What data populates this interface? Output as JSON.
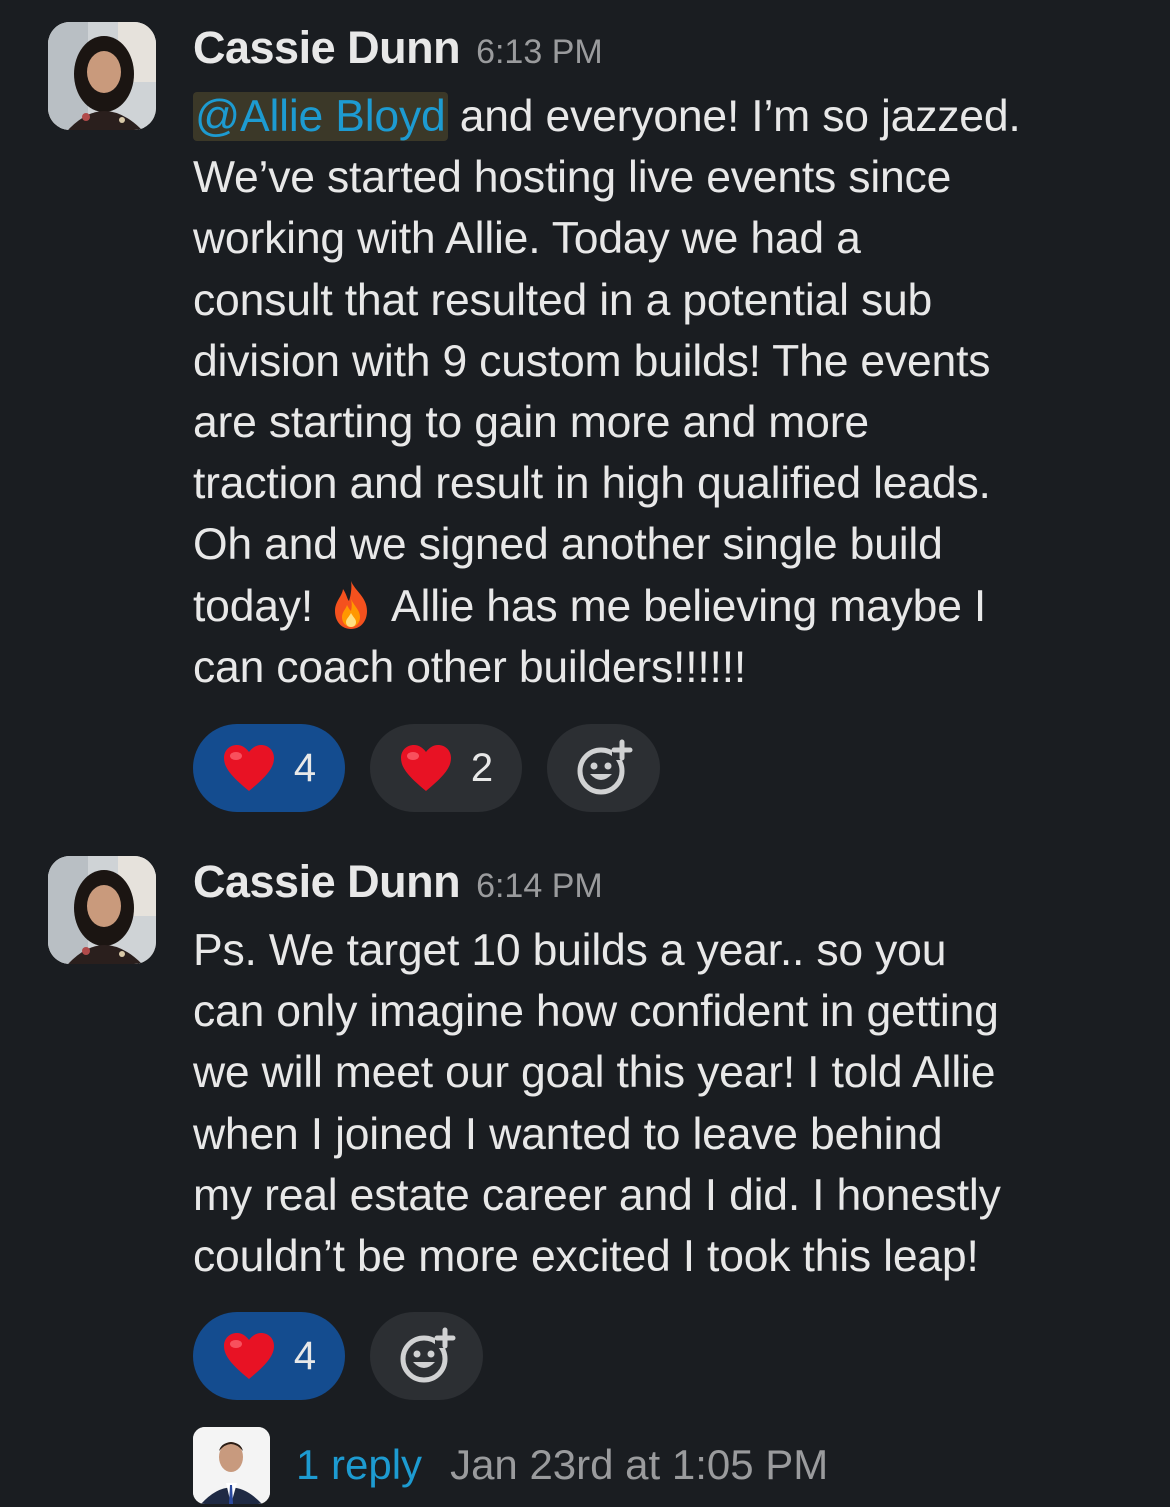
{
  "messages": [
    {
      "author": "Cassie Dunn",
      "time": "6:13 PM",
      "mention": "@Allie Bloyd",
      "lines": [
        " and everyone! I’m so jazzed.",
        "We’ve started hosting live events since",
        "working with Allie. Today we had a",
        "consult that resulted in a potential sub",
        "division with 9 custom builds! The events",
        "are starting to gain more and more",
        "traction and result in high qualified leads.",
        "Oh and we signed another single build",
        "today!",
        "Allie has me believing maybe I",
        "can coach other builders!!!!!!"
      ],
      "inline_emoji": "fire-emoji",
      "reactions": [
        {
          "emoji": "heart-emoji",
          "count": "4",
          "active": true
        },
        {
          "emoji": "heart-emoji",
          "count": "2",
          "active": false
        }
      ]
    },
    {
      "author": "Cassie Dunn",
      "time": "6:14 PM",
      "lines": [
        "Ps. We target 10 builds a year.. so you",
        "can only imagine how confident in getting",
        "we will meet our goal this year! I told Allie",
        "when I joined I wanted to leave behind",
        "my real estate career and I did. I honestly",
        "couldn’t be more excited I took this leap!"
      ],
      "reactions": [
        {
          "emoji": "heart-emoji",
          "count": "4",
          "active": true
        }
      ]
    }
  ],
  "thread": {
    "reply_label": "1 reply",
    "timestamp": "Jan 23rd at 1:05 PM"
  },
  "colors": {
    "background": "#1a1d21",
    "mention": "#1d9bd1",
    "active_reaction": "#144c8f",
    "inactive_reaction": "#2c2f33"
  }
}
